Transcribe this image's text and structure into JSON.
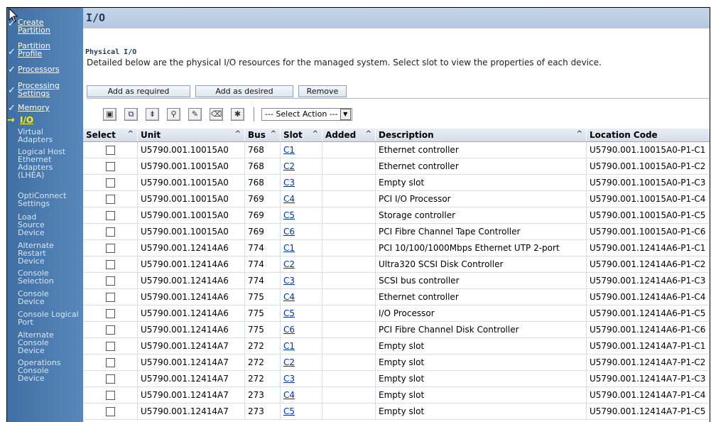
{
  "title": "I/O",
  "section": {
    "title": "Physical I/O",
    "description": "Detailed below are the physical I/O resources for the managed system. Select slot to view the properties of each device."
  },
  "buttons": {
    "add_required": "Add as required",
    "add_desired": "Add as desired",
    "remove": "Remove"
  },
  "select_action": "--- Select Action ---",
  "nav": [
    {
      "label": "Create Partition",
      "state": "done"
    },
    {
      "label": "Partition Profile",
      "state": "done"
    },
    {
      "label": "Processors",
      "state": "done"
    },
    {
      "label": "Processing Settings",
      "state": "done"
    },
    {
      "label": "Memory",
      "state": "done"
    },
    {
      "label": "I/O",
      "state": "current"
    },
    {
      "label": "Virtual Adapters",
      "state": "todo"
    },
    {
      "label": "Logical Host Ethernet Adapters (LHEA)",
      "state": "todo"
    },
    {
      "label": "OptiConnect Settings",
      "state": "todo"
    },
    {
      "label": "Load Source Device",
      "state": "todo"
    },
    {
      "label": "Alternate Restart Device",
      "state": "todo"
    },
    {
      "label": "Console Selection",
      "state": "todo"
    },
    {
      "label": "Console Device",
      "state": "todo"
    },
    {
      "label": "Console Logical Port",
      "state": "todo"
    },
    {
      "label": "Alternate Console Device",
      "state": "todo"
    },
    {
      "label": "Operations Console Device",
      "state": "todo"
    }
  ],
  "table": {
    "headers": {
      "select": "Select",
      "unit": "Unit",
      "bus": "Bus",
      "slot": "Slot",
      "added": "Added",
      "description": "Description",
      "location": "Location Code"
    },
    "sort_indicator": "^",
    "rows": [
      {
        "unit": "U5790.001.10015A0",
        "bus": "768",
        "slot": "C1",
        "added": "",
        "description": "Ethernet controller",
        "location": "U5790.001.10015A0-P1-C1"
      },
      {
        "unit": "U5790.001.10015A0",
        "bus": "768",
        "slot": "C2",
        "added": "",
        "description": "Ethernet controller",
        "location": "U5790.001.10015A0-P1-C2"
      },
      {
        "unit": "U5790.001.10015A0",
        "bus": "768",
        "slot": "C3",
        "added": "",
        "description": "Empty slot",
        "location": "U5790.001.10015A0-P1-C3"
      },
      {
        "unit": "U5790.001.10015A0",
        "bus": "769",
        "slot": "C4",
        "added": "",
        "description": "PCI I/O Processor",
        "location": "U5790.001.10015A0-P1-C4"
      },
      {
        "unit": "U5790.001.10015A0",
        "bus": "769",
        "slot": "C5",
        "added": "",
        "description": "Storage controller",
        "location": "U5790.001.10015A0-P1-C5"
      },
      {
        "unit": "U5790.001.10015A0",
        "bus": "769",
        "slot": "C6",
        "added": "",
        "description": "PCI Fibre Channel Tape Controller",
        "location": "U5790.001.10015A0-P1-C6"
      },
      {
        "unit": "U5790.001.12414A6",
        "bus": "774",
        "slot": "C1",
        "added": "",
        "description": "PCI 10/100/1000Mbps Ethernet UTP 2-port",
        "location": "U5790.001.12414A6-P1-C1"
      },
      {
        "unit": "U5790.001.12414A6",
        "bus": "774",
        "slot": "C2",
        "added": "",
        "description": "Ultra320 SCSI Disk Controller",
        "location": "U5790.001.12414A6-P1-C2"
      },
      {
        "unit": "U5790.001.12414A6",
        "bus": "774",
        "slot": "C3",
        "added": "",
        "description": "SCSI bus controller",
        "location": "U5790.001.12414A6-P1-C3"
      },
      {
        "unit": "U5790.001.12414A6",
        "bus": "775",
        "slot": "C4",
        "added": "",
        "description": "Ethernet controller",
        "location": "U5790.001.12414A6-P1-C4"
      },
      {
        "unit": "U5790.001.12414A6",
        "bus": "775",
        "slot": "C5",
        "added": "",
        "description": "I/O Processor",
        "location": "U5790.001.12414A6-P1-C5"
      },
      {
        "unit": "U5790.001.12414A6",
        "bus": "775",
        "slot": "C6",
        "added": "",
        "description": "PCI Fibre Channel Disk Controller",
        "location": "U5790.001.12414A6-P1-C6"
      },
      {
        "unit": "U5790.001.12414A7",
        "bus": "272",
        "slot": "C1",
        "added": "",
        "description": "Empty slot",
        "location": "U5790.001.12414A7-P1-C1"
      },
      {
        "unit": "U5790.001.12414A7",
        "bus": "272",
        "slot": "C2",
        "added": "",
        "description": "Empty slot",
        "location": "U5790.001.12414A7-P1-C2"
      },
      {
        "unit": "U5790.001.12414A7",
        "bus": "272",
        "slot": "C3",
        "added": "",
        "description": "Empty slot",
        "location": "U5790.001.12414A7-P1-C3"
      },
      {
        "unit": "U5790.001.12414A7",
        "bus": "273",
        "slot": "C4",
        "added": "",
        "description": "Empty slot",
        "location": "U5790.001.12414A7-P1-C4"
      },
      {
        "unit": "U5790.001.12414A7",
        "bus": "273",
        "slot": "C5",
        "added": "",
        "description": "Empty slot",
        "location": "U5790.001.12414A7-P1-C5"
      }
    ]
  },
  "toolbar_icons": [
    "select-all-icon",
    "deselect-all-icon",
    "expand-icon",
    "filter-icon",
    "edit-sort-icon",
    "clear-sort-icon",
    "configure-columns-icon"
  ]
}
